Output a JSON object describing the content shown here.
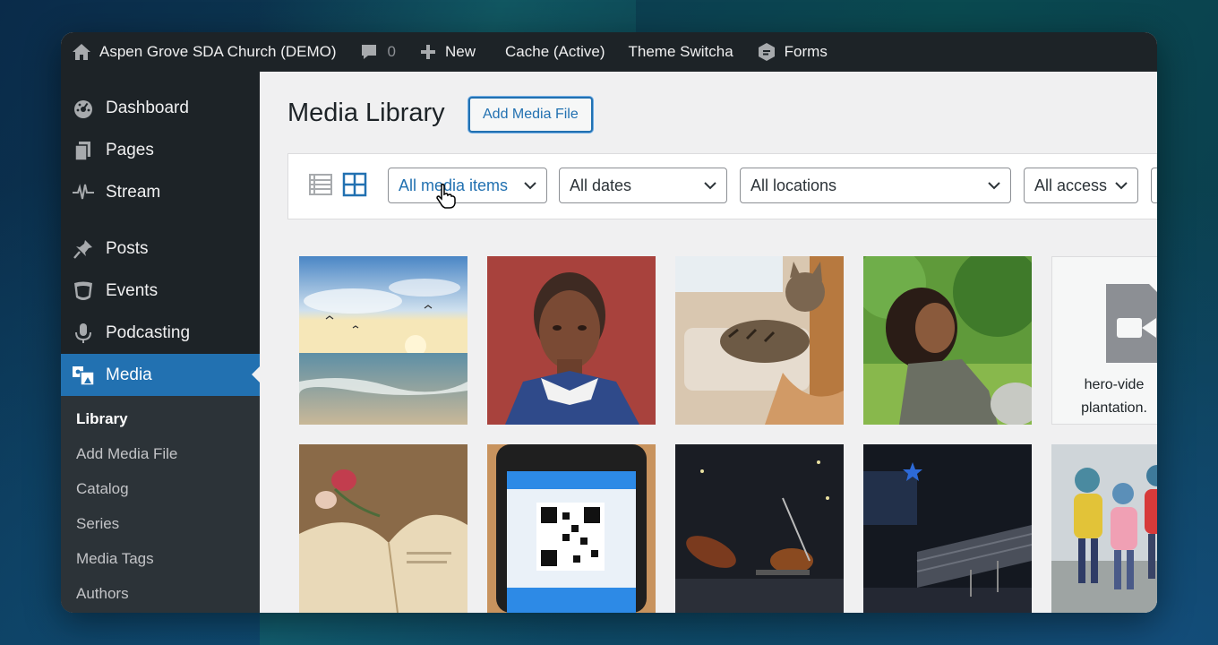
{
  "admin_bar": {
    "site_name": "Aspen Grove SDA Church (DEMO)",
    "comments_count": "0",
    "new_label": "New",
    "cache_label": "Cache (Active)",
    "theme_label": "Theme Switcha",
    "forms_label": "Forms"
  },
  "sidebar": {
    "items": [
      {
        "label": "Dashboard",
        "icon": "dashboard-icon"
      },
      {
        "label": "Pages",
        "icon": "pages-icon"
      },
      {
        "label": "Stream",
        "icon": "stream-icon"
      },
      {
        "label": "Posts",
        "icon": "pin-icon"
      },
      {
        "label": "Events",
        "icon": "events-icon"
      },
      {
        "label": "Podcasting",
        "icon": "microphone-icon"
      },
      {
        "label": "Media",
        "icon": "media-icon"
      }
    ],
    "submenu": [
      "Library",
      "Add Media File",
      "Catalog",
      "Series",
      "Media Tags",
      "Authors"
    ]
  },
  "main": {
    "title": "Media Library",
    "add_button": "Add Media File",
    "filters": {
      "type": "All media items",
      "dates": "All dates",
      "locations": "All locations",
      "access": "All access"
    },
    "file_tile": {
      "line1": "hero-vide",
      "line2": "plantation."
    }
  },
  "colors": {
    "accent": "#2271b1",
    "admin_dark": "#1d2327",
    "submenu_bg": "#2c3338"
  }
}
